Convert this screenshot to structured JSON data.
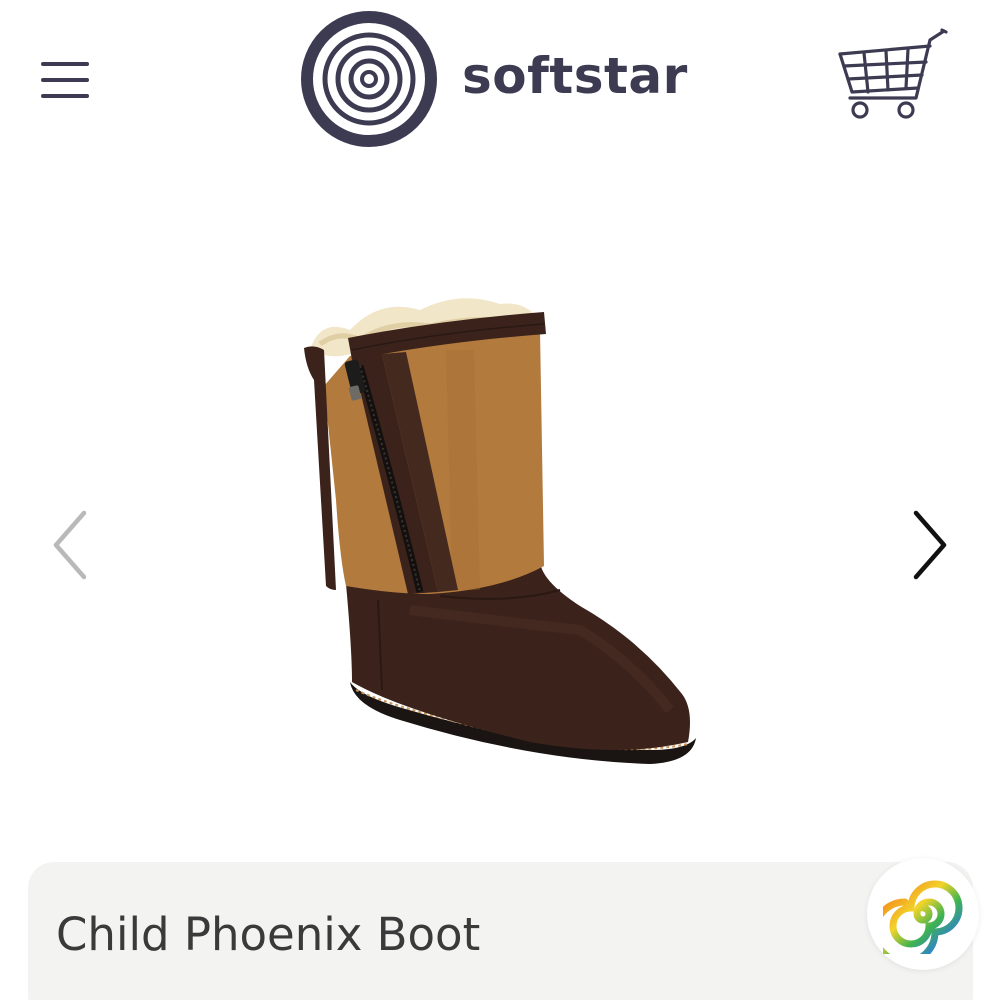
{
  "header": {
    "menu_icon": "hamburger-menu-icon",
    "logo_text": "softstar",
    "logo_icon": "concentric-circles-logo",
    "cart_icon": "shopping-cart-icon"
  },
  "carousel": {
    "image_alt": "Child Phoenix Boot",
    "prev_icon": "chevron-left-icon",
    "next_icon": "chevron-right-icon"
  },
  "product": {
    "title": "Child Phoenix Boot"
  },
  "badge": {
    "icon": "rainbow-spiral-icon"
  },
  "colors": {
    "brand": "#3d3b52",
    "boot_leather": "#3b231b",
    "boot_suede": "#b37a3e",
    "fleece": "#f2e6c8",
    "card_bg": "#f3f3f2",
    "prev_arrow": "#b9b9b9",
    "next_arrow": "#111111"
  }
}
